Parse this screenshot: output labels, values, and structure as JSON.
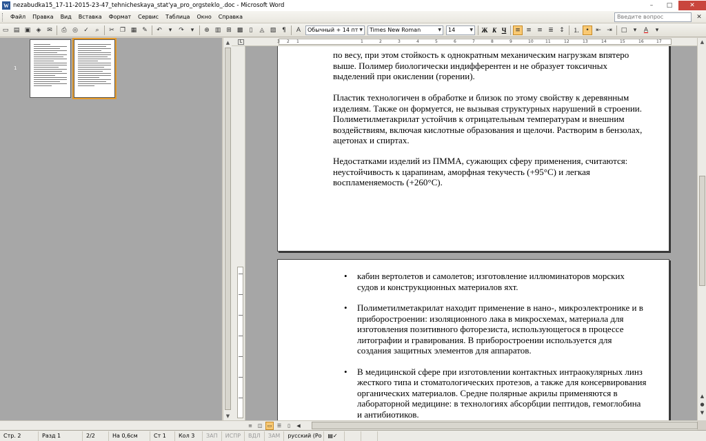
{
  "window": {
    "title": "nezabudka15_17-11-2015-23-47_tehnicheskaya_stat'ya_pro_orgsteklo_.doc - Microsoft Word",
    "app_icon": "W",
    "minimize": "–",
    "maximize": "□",
    "close": "✕"
  },
  "menu": {
    "items": [
      "Файл",
      "Правка",
      "Вид",
      "Вставка",
      "Формат",
      "Сервис",
      "Таблица",
      "Окно",
      "Справка"
    ],
    "help_placeholder": "Введите вопрос",
    "doc_close": "✕"
  },
  "toolbar": {
    "style_value": "Обычный + 14 пт",
    "font_value": "Times New Roman",
    "size_value": "14",
    "bold_label": "Ж",
    "italic_label": "К",
    "underline_label": "Ч"
  },
  "thumbnails": {
    "page_label": "1"
  },
  "ruler": {
    "corner": "L",
    "ticks": [
      "3",
      "2",
      "1",
      "1",
      "2",
      "3",
      "4",
      "5",
      "6",
      "7",
      "8",
      "9",
      "10",
      "11",
      "12",
      "13",
      "14",
      "15",
      "16",
      "17"
    ]
  },
  "document": {
    "page1": {
      "para1": "по весу, при этом стойкость к однократным механическим нагрузкам впятеро выше. Полимер биологически индифферентен и не образует токсичных выделений при окислении (горении).",
      "para2": "Пластик технологичен в обработке и близок по этому свойству к деревянным изделиям. Также он формуется, не вызывая структурных нарушений в строении. Полиметилметакрилат устойчив к отрицательным температурам и внешним воздействиям, включая кислотные образования и щелочи. Растворим в бензолах, ацетонах и спиртах.",
      "para3": "Недостатками изделий из ПММА, сужающих сферу применения, считаются: неустойчивость к царапинам, аморфная текучесть (+95°С)  и легкая воспламеняемость (+260°С)."
    },
    "page2": {
      "bullet": "•",
      "items": [
        "кабин вертолетов и самолетов; изготовление иллюминаторов морских судов и конструкционных материалов яхт.",
        "Полиметилметакрилат находит применение в нано-, микроэлектронике и в приборостроении: изоляционного лака в микросхемах, материала для изготовления позитивного фоторезиста, использующегося в процессе литографии и гравирования. В приборостроении используется для создания защитных элементов для аппаратов.",
        "В медицинской сфере при изготовлении контактных интраокулярных линз жесткого типа и стоматологических протезов, а также для консервирования органических материалов. Средне полярные акрилы применяются в лабораторной медицине: в технологиях абсорбции пептидов, гемоглобина и антибиотиков."
      ]
    }
  },
  "statusbar": {
    "page": "Стр. 2",
    "section": "Разд 1",
    "pages": "2/2",
    "at": "На 0,6см",
    "line": "Ст 1",
    "col": "Кол 3",
    "rec": "ЗАП",
    "trk": "ИСПР",
    "ext": "ВДЛ",
    "ovr": "ЗАМ",
    "lang": "русский (Ро"
  }
}
